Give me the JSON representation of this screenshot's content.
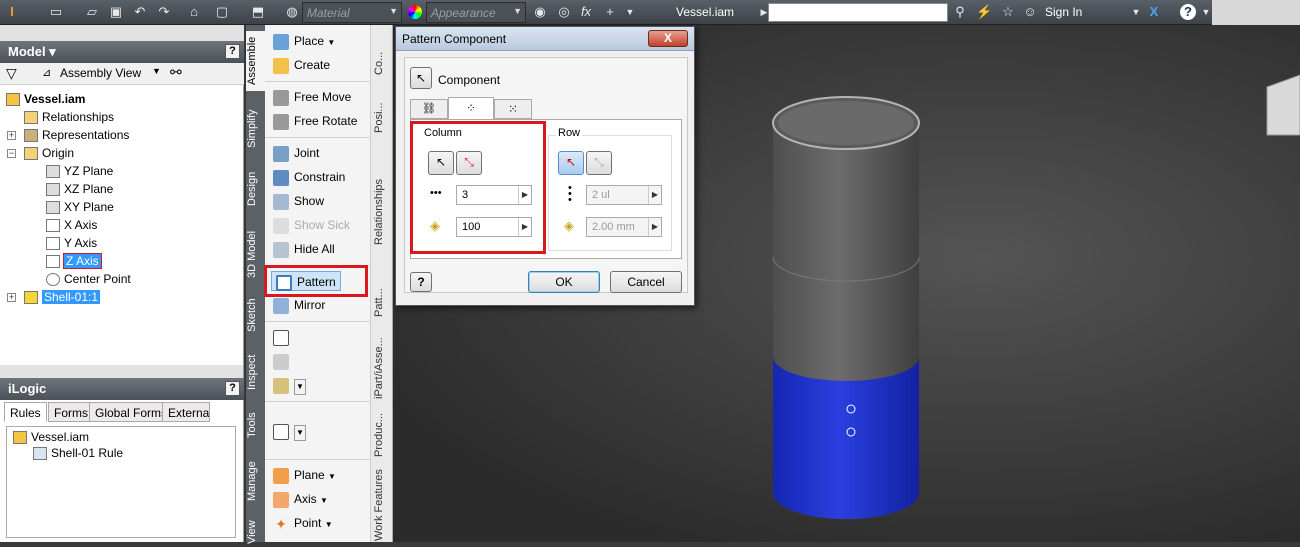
{
  "toolbar": {
    "material": "Material",
    "appearance": "Appearance",
    "doc_title": "Vessel.iam",
    "sign_in": "Sign In",
    "fx": "fx"
  },
  "model": {
    "title": "Model",
    "view": "Assembly View",
    "tree": {
      "root": "Vessel.iam",
      "relationships": "Relationships",
      "representations": "Representations",
      "origin": "Origin",
      "yz": "YZ Plane",
      "xz": "XZ Plane",
      "xy": "XY Plane",
      "xaxis": "X Axis",
      "yaxis": "Y Axis",
      "zaxis": "Z Axis",
      "center": "Center Point",
      "shell": "Shell-01:1"
    }
  },
  "ilogic": {
    "title": "iLogic",
    "tabs": [
      "Rules",
      "Forms",
      "Global Forms",
      "Externa"
    ],
    "root": "Vessel.iam",
    "rule": "Shell-01 Rule"
  },
  "vtabs": [
    "Assemble",
    "Simplify",
    "Design",
    "3D Model",
    "Sketch",
    "Inspect",
    "Tools",
    "Manage",
    "View"
  ],
  "ribbon": {
    "place": "Place",
    "create": "Create",
    "free_move": "Free Move",
    "free_rotate": "Free Rotate",
    "joint": "Joint",
    "constrain": "Constrain",
    "show": "Show",
    "show_sick": "Show Sick",
    "hide_all": "Hide All",
    "pattern": "Pattern",
    "mirror": "Mirror",
    "plane": "Plane",
    "axis": "Axis",
    "point": "Point"
  },
  "panel_labels": [
    "Co...",
    "Posi...",
    "Relationships",
    "Patt...",
    "iPart/iAsse...",
    "Produc...",
    "Work Features"
  ],
  "dialog": {
    "title": "Pattern Component",
    "close": "X",
    "component": "Component",
    "column_label": "Column",
    "column_count": "3",
    "column_spacing": "100",
    "row_label": "Row",
    "row_count": "2 ul",
    "row_spacing": "2.00 mm",
    "ok": "OK",
    "cancel": "Cancel",
    "help": "?"
  },
  "colors": {
    "accent": "#3399ff",
    "highlight": "#d7191f",
    "shell_blue": "#1d31c9"
  }
}
